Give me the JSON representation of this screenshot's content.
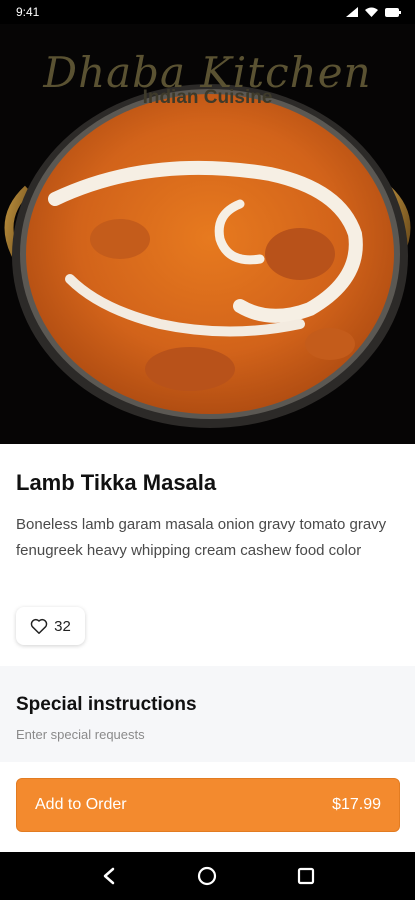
{
  "status_bar": {
    "time": "9:41"
  },
  "restaurant": {
    "name": "Dhaba Kitchen",
    "subtitle": "Indian Cuisine"
  },
  "item": {
    "name": "Lamb Tikka Masala",
    "description": "Boneless lamb garam masala onion gravy tomato gravy fenugreek heavy whipping cream cashew food color",
    "likes": "32"
  },
  "special_instructions": {
    "title": "Special instructions",
    "placeholder": "Enter special requests",
    "value": ""
  },
  "order": {
    "add_label": "Add to Order",
    "price": "$17.99"
  },
  "colors": {
    "accent": "#f38a2e",
    "hero_bg": "#060505",
    "section_bg": "#f6f7f9"
  },
  "icons": {
    "status": [
      "signal-icon",
      "wifi-icon",
      "battery-icon"
    ],
    "like": "heart-icon",
    "nav": [
      "back-icon",
      "home-icon",
      "recents-icon"
    ]
  }
}
